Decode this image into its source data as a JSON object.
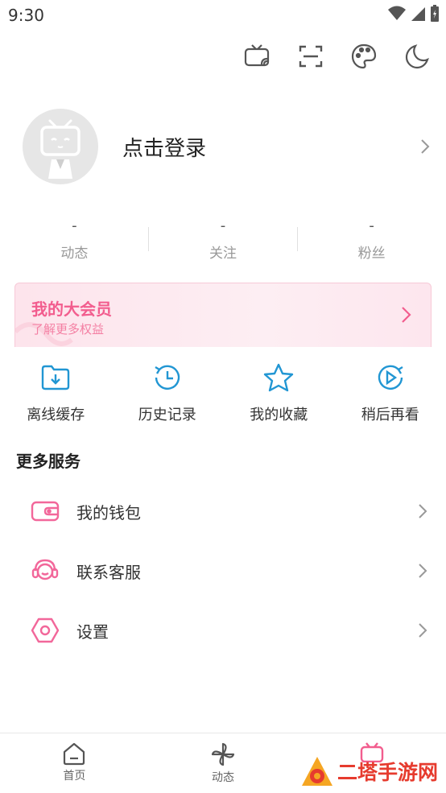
{
  "status_bar": {
    "time": "9:30"
  },
  "profile": {
    "login_text": "点击登录"
  },
  "stats": [
    {
      "value": "-",
      "label": "动态"
    },
    {
      "value": "-",
      "label": "关注"
    },
    {
      "value": "-",
      "label": "粉丝"
    }
  ],
  "vip": {
    "title": "我的大会员",
    "subtitle": "了解更多权益"
  },
  "quick_actions": [
    {
      "label": "离线缓存",
      "icon": "offline-cache-icon"
    },
    {
      "label": "历史记录",
      "icon": "history-icon"
    },
    {
      "label": "我的收藏",
      "icon": "favorites-star-icon"
    },
    {
      "label": "稍后再看",
      "icon": "watch-later-icon"
    }
  ],
  "more_services": {
    "title": "更多服务",
    "items": [
      {
        "label": "我的钱包",
        "icon": "wallet-icon"
      },
      {
        "label": "联系客服",
        "icon": "customer-service-icon"
      },
      {
        "label": "设置",
        "icon": "settings-icon"
      }
    ]
  },
  "tabbar": {
    "tabs": [
      {
        "label": "首页",
        "icon": "home-icon"
      },
      {
        "label": "动态",
        "icon": "pinwheel-icon"
      },
      {
        "label": "",
        "icon": "tv-icon"
      }
    ]
  },
  "watermark": {
    "text": "二塔手游网"
  },
  "colors": {
    "accent_pink": "#f25d8e",
    "accent_blue": "#2196d3"
  }
}
